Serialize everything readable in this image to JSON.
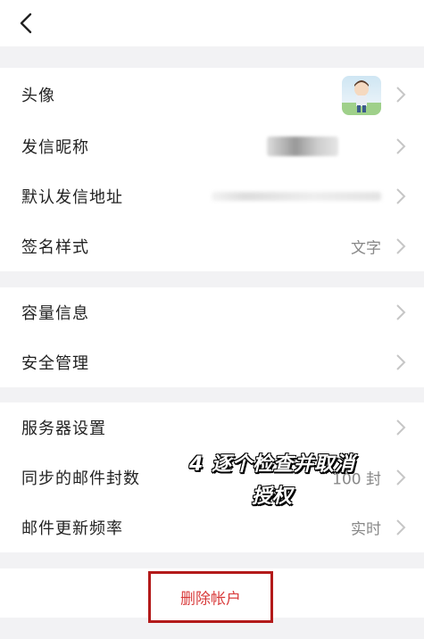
{
  "nav": {
    "back_icon": "chevron-left-icon"
  },
  "account_group": [
    {
      "key": "avatar",
      "label": "头像"
    },
    {
      "key": "nickname",
      "label": "发信昵称"
    },
    {
      "key": "sender_address",
      "label": "默认发信地址"
    },
    {
      "key": "signature_style",
      "label": "签名样式",
      "value": "文字"
    }
  ],
  "security_group": [
    {
      "key": "storage",
      "label": "容量信息"
    },
    {
      "key": "security",
      "label": "安全管理"
    }
  ],
  "server_group": [
    {
      "key": "server_settings",
      "label": "服务器设置"
    },
    {
      "key": "sync_count",
      "label": "同步的邮件封数",
      "value": "100 封"
    },
    {
      "key": "update_frequency",
      "label": "邮件更新频率",
      "value": "实时"
    }
  ],
  "overlay_caption": {
    "line1": "4 逐个检查并取消",
    "line2": "授权"
  },
  "delete_account": {
    "label": "删除帐户",
    "text_color": "#d83b3b",
    "border_color": "#b31a1a"
  },
  "icons": {
    "row_chevron": "chevron-right-icon"
  }
}
